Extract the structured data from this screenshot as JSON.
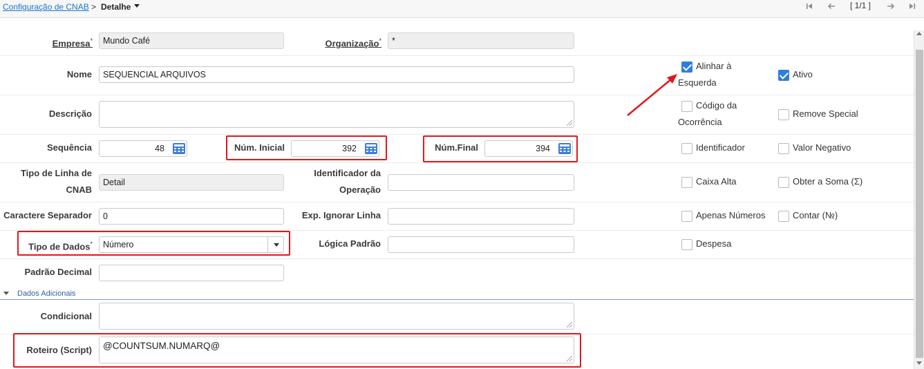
{
  "breadcrumb": {
    "parent": "Configuração de CNAB",
    "separator": ">",
    "current": "Detalhe"
  },
  "pager": {
    "text": "[ 1/1 ]"
  },
  "fields": {
    "empresa": {
      "label": "Empresa",
      "value": "Mundo Café"
    },
    "organizacao": {
      "label": "Organização",
      "value": "*"
    },
    "nome": {
      "label": "Nome",
      "value": "SEQUENCIAL ARQUIVOS"
    },
    "descricao": {
      "label": "Descrição",
      "value": ""
    },
    "sequencia": {
      "label": "Sequência",
      "value": "48"
    },
    "num_inicial": {
      "label": "Núm. Inicial",
      "value": "392"
    },
    "num_final": {
      "label": "Núm.Final",
      "value": "394"
    },
    "tipo_linha": {
      "label_line1": "Tipo de Linha de",
      "label_line2": "CNAB",
      "value": "Detail"
    },
    "identificador_operacao": {
      "label_line1": "Identificador da",
      "label_line2": "Operação",
      "value": ""
    },
    "caractere_separador": {
      "label": "Caractere Separador",
      "value": "0"
    },
    "exp_ignorar_linha": {
      "label": "Exp. Ignorar Linha",
      "value": ""
    },
    "tipo_dados": {
      "label": "Tipo de Dados",
      "value": "Número"
    },
    "logica_padrao": {
      "label": "Lógica Padrão",
      "value": ""
    },
    "padrao_decimal": {
      "label": "Padrão Decimal",
      "value": ""
    },
    "condicional": {
      "label": "Condicional",
      "value": ""
    },
    "roteiro": {
      "label": "Roteiro (Script)",
      "value": "@COUNTSUM.NUMARQ@"
    }
  },
  "required_mark": "*",
  "checkboxes": {
    "alinhar": {
      "label_line1": "Alinhar à",
      "label_line2": "Esquerda",
      "checked": true
    },
    "ativo": {
      "label": "Ativo",
      "checked": true
    },
    "codigo_ocorrencia": {
      "label_line1": "Código da",
      "label_line2": "Ocorrência",
      "checked": false
    },
    "remove_special": {
      "label": "Remove Special",
      "checked": false
    },
    "identificador": {
      "label": "Identificador",
      "checked": false
    },
    "valor_negativo": {
      "label": "Valor Negativo",
      "checked": false
    },
    "caixa_alta": {
      "label": "Caixa Alta",
      "checked": false
    },
    "obter_soma": {
      "label": "Obter a Soma (Σ)",
      "checked": false
    },
    "apenas_numeros": {
      "label": "Apenas Números",
      "checked": false
    },
    "contar": {
      "label": "Contar (№)",
      "checked": false
    },
    "despesa": {
      "label": "Despesa",
      "checked": false
    }
  },
  "section": {
    "title": "Dados Adicionais"
  },
  "colors": {
    "highlight": "#e3161b",
    "checkbox": "#2e7de1",
    "link": "#1a73c8"
  }
}
